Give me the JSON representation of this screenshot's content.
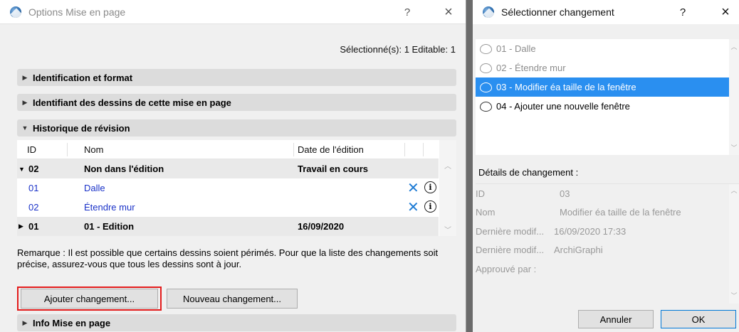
{
  "left_dialog": {
    "title": "Options Mise en page",
    "help": "?",
    "close": "×",
    "selected_info": "Sélectionné(s): 1 Editable: 1",
    "sections": {
      "ident_format": "Identification et format",
      "ident_drawings": "Identifiant des dessins de cette mise en page",
      "revision_history": "Historique de révision",
      "info_layout": "Info Mise en page"
    },
    "table": {
      "headers": [
        "ID",
        "Nom",
        "Date de l'édition"
      ],
      "rows": [
        {
          "id": "02",
          "name": "Non dans l'édition",
          "date": "Travail en cours"
        },
        {
          "id": "01",
          "name": "Dalle",
          "date": ""
        },
        {
          "id": "02",
          "name": "Étendre mur",
          "date": ""
        },
        {
          "id": "01",
          "name": "01 - Edition",
          "date": "16/09/2020"
        }
      ]
    },
    "remark": "Remarque : Il est possible que certains dessins soient périmés. Pour que la liste des changements soit précise, assurez-vous que tous les dessins sont à jour.",
    "buttons": {
      "add_change": "Ajouter changement...",
      "new_change": "Nouveau changement..."
    }
  },
  "right_dialog": {
    "title": "Sélectionner changement",
    "help": "?",
    "close": "×",
    "items": [
      "01 - Dalle",
      "02 - Étendre mur",
      "03 - Modifier éa taille de la fenêtre",
      "04 - Ajouter une nouvelle fenêtre"
    ],
    "selected_index": 2,
    "details_title": "Détails de changement :",
    "details": [
      {
        "key": "ID",
        "value": "03"
      },
      {
        "key": "Nom",
        "value": "Modifier éa taille de la fenêtre"
      },
      {
        "key": "Dernière modif...",
        "value": "16/09/2020 17:33"
      },
      {
        "key": "Dernière modif...",
        "value": "ArchiGraphi"
      },
      {
        "key": "Approuvé par :",
        "value": ""
      }
    ],
    "buttons": {
      "cancel": "Annuler",
      "ok": "OK"
    }
  },
  "colors": {
    "selection": "#2a8ff0",
    "link_blue": "#1a32c8",
    "delete_x": "#1e7bd4",
    "highlight_border": "#e31b1b"
  }
}
